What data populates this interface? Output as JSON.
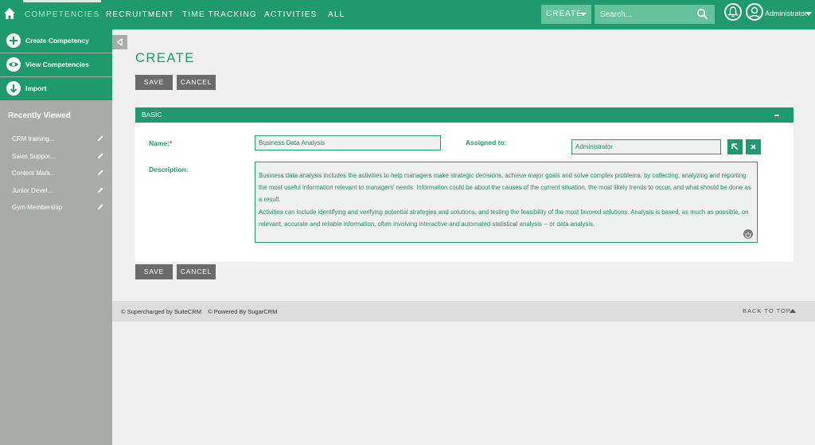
{
  "nav": {
    "home_icon": "home-icon",
    "items": [
      {
        "label": "COMPETENCIES",
        "active": true
      },
      {
        "label": "RECRUITMENT",
        "active": false
      },
      {
        "label": "TIME TRACKING",
        "active": false
      },
      {
        "label": "ACTIVITIES",
        "active": false
      },
      {
        "label": "ALL",
        "active": false
      }
    ],
    "create_label": "CREATE",
    "search_placeholder": "Search...",
    "user_name": "Administrator"
  },
  "sidebar": {
    "actions": [
      {
        "label": "Create Competency",
        "icon": "plus-circle-icon"
      },
      {
        "label": "View Competencies",
        "icon": "eye-icon"
      },
      {
        "label": "Import",
        "icon": "download-arrow-icon"
      }
    ],
    "recent_title": "Recently Viewed",
    "recent": [
      "CRM training...",
      "Sales Suppor...",
      "Content Mark...",
      "Junior Devel...",
      "Gym Membership"
    ]
  },
  "page": {
    "title": "CREATE",
    "save_label": "SAVE",
    "cancel_label": "CANCEL"
  },
  "panel": {
    "title": "BASIC",
    "name_label": "Name:",
    "required_mark": "*",
    "name_value": "Business Data Analysis",
    "assigned_label": "Assigned to:",
    "assigned_value": "Administrator",
    "description_label": "Description:",
    "description_value": "Business data analysis includes the activities to help managers make strategic decisions, achieve major goals and solve complex problems, by collecting, analyzing and reporting the most useful information relevant to managers' needs. Information could be about the causes of the current situation, the most likely trends to occur, and what should be done as a result.\nActivities can include identifying and verifying potential strategies and solutions, and testing the feasibility of the most favored solutions. Analysis is based, as much as possible, on relevant, accurate and reliable information, often involving interactive and automated statistical analysis -- or data analysis."
  },
  "footer": {
    "supercharged": "© Supercharged by SuiteCRM",
    "powered": "© Powered By SugarCRM",
    "back_to_top": "BACK TO TOP"
  },
  "colors": {
    "brand": "#1f9a6f",
    "sidebar": "#a9aba8",
    "button": "#6b6b6b"
  }
}
